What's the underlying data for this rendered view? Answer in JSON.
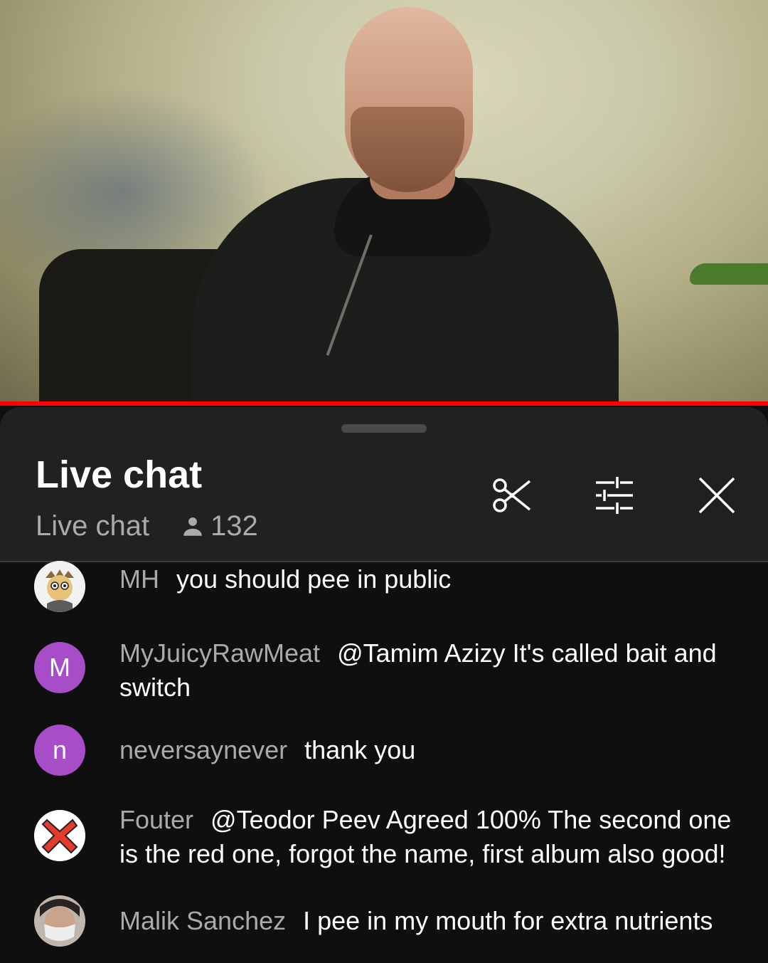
{
  "header": {
    "title": "Live chat",
    "mode_label": "Live chat",
    "viewer_count": "132",
    "icons": {
      "viewers": "person-icon",
      "clip": "scissors-icon",
      "settings": "sliders-icon",
      "close": "close-icon"
    }
  },
  "colors": {
    "accent": "#ff0000",
    "avatar_purple": "#a64dc7"
  },
  "messages": [
    {
      "author": "MH",
      "text": "you should pee in public",
      "avatar": "cartoon-avatar"
    },
    {
      "author": "MyJuicyRawMeat",
      "text": "@Tamim Azizy It's called bait and switch",
      "avatar_letter": "M"
    },
    {
      "author": "neversaynever",
      "text": "thank you",
      "avatar_letter": "n"
    },
    {
      "author": "Fouter",
      "text": "@Teodor Peev Agreed 100% The second one is the red one, forgot the name, first album also good!",
      "avatar": "red-x-avatar"
    },
    {
      "author": "Malik Sanchez",
      "text": "I pee in my mouth for extra nutrients",
      "avatar": "photo-avatar"
    }
  ]
}
